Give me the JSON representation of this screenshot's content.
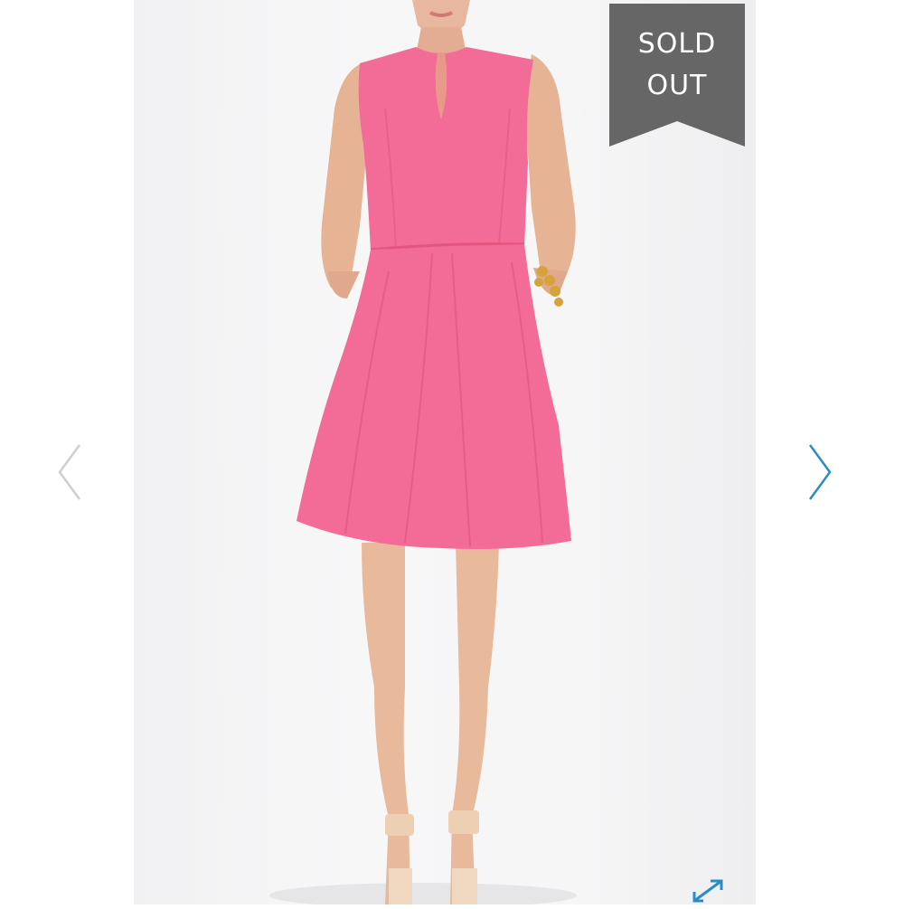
{
  "product_gallery": {
    "badge": {
      "line1": "SOLD",
      "line2": "OUT",
      "background": "#666666",
      "text_color": "#ffffff"
    },
    "prev_icon": "chevron-left-icon",
    "next_icon": "chevron-right-icon",
    "expand_icon": "expand-icon",
    "colors": {
      "arrow_prev": "#cfcfd2",
      "arrow_next": "#2b8cc4",
      "expand": "#2b8cc4",
      "dress": "#f36b97"
    }
  }
}
